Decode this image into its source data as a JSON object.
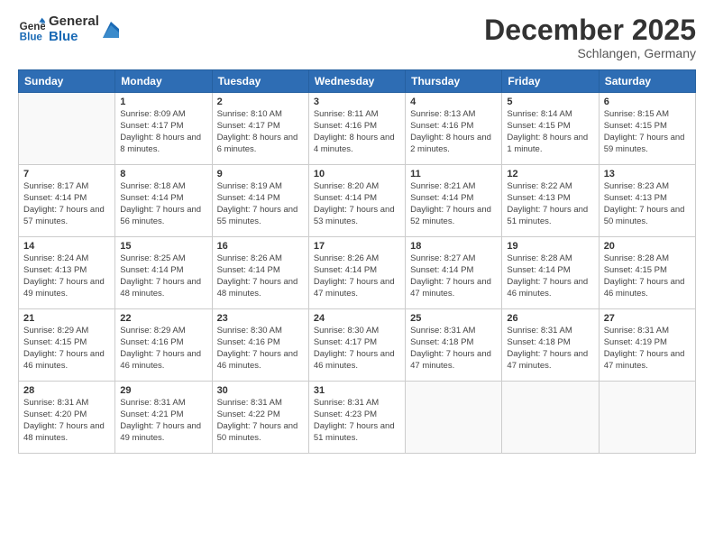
{
  "header": {
    "logo_line1": "General",
    "logo_line2": "Blue",
    "month_title": "December 2025",
    "location": "Schlangen, Germany"
  },
  "weekdays": [
    "Sunday",
    "Monday",
    "Tuesday",
    "Wednesday",
    "Thursday",
    "Friday",
    "Saturday"
  ],
  "weeks": [
    [
      {
        "day": "",
        "sunrise": "",
        "sunset": "",
        "daylight": ""
      },
      {
        "day": "1",
        "sunrise": "Sunrise: 8:09 AM",
        "sunset": "Sunset: 4:17 PM",
        "daylight": "Daylight: 8 hours and 8 minutes."
      },
      {
        "day": "2",
        "sunrise": "Sunrise: 8:10 AM",
        "sunset": "Sunset: 4:17 PM",
        "daylight": "Daylight: 8 hours and 6 minutes."
      },
      {
        "day": "3",
        "sunrise": "Sunrise: 8:11 AM",
        "sunset": "Sunset: 4:16 PM",
        "daylight": "Daylight: 8 hours and 4 minutes."
      },
      {
        "day": "4",
        "sunrise": "Sunrise: 8:13 AM",
        "sunset": "Sunset: 4:16 PM",
        "daylight": "Daylight: 8 hours and 2 minutes."
      },
      {
        "day": "5",
        "sunrise": "Sunrise: 8:14 AM",
        "sunset": "Sunset: 4:15 PM",
        "daylight": "Daylight: 8 hours and 1 minute."
      },
      {
        "day": "6",
        "sunrise": "Sunrise: 8:15 AM",
        "sunset": "Sunset: 4:15 PM",
        "daylight": "Daylight: 7 hours and 59 minutes."
      }
    ],
    [
      {
        "day": "7",
        "sunrise": "Sunrise: 8:17 AM",
        "sunset": "Sunset: 4:14 PM",
        "daylight": "Daylight: 7 hours and 57 minutes."
      },
      {
        "day": "8",
        "sunrise": "Sunrise: 8:18 AM",
        "sunset": "Sunset: 4:14 PM",
        "daylight": "Daylight: 7 hours and 56 minutes."
      },
      {
        "day": "9",
        "sunrise": "Sunrise: 8:19 AM",
        "sunset": "Sunset: 4:14 PM",
        "daylight": "Daylight: 7 hours and 55 minutes."
      },
      {
        "day": "10",
        "sunrise": "Sunrise: 8:20 AM",
        "sunset": "Sunset: 4:14 PM",
        "daylight": "Daylight: 7 hours and 53 minutes."
      },
      {
        "day": "11",
        "sunrise": "Sunrise: 8:21 AM",
        "sunset": "Sunset: 4:14 PM",
        "daylight": "Daylight: 7 hours and 52 minutes."
      },
      {
        "day": "12",
        "sunrise": "Sunrise: 8:22 AM",
        "sunset": "Sunset: 4:13 PM",
        "daylight": "Daylight: 7 hours and 51 minutes."
      },
      {
        "day": "13",
        "sunrise": "Sunrise: 8:23 AM",
        "sunset": "Sunset: 4:13 PM",
        "daylight": "Daylight: 7 hours and 50 minutes."
      }
    ],
    [
      {
        "day": "14",
        "sunrise": "Sunrise: 8:24 AM",
        "sunset": "Sunset: 4:13 PM",
        "daylight": "Daylight: 7 hours and 49 minutes."
      },
      {
        "day": "15",
        "sunrise": "Sunrise: 8:25 AM",
        "sunset": "Sunset: 4:14 PM",
        "daylight": "Daylight: 7 hours and 48 minutes."
      },
      {
        "day": "16",
        "sunrise": "Sunrise: 8:26 AM",
        "sunset": "Sunset: 4:14 PM",
        "daylight": "Daylight: 7 hours and 48 minutes."
      },
      {
        "day": "17",
        "sunrise": "Sunrise: 8:26 AM",
        "sunset": "Sunset: 4:14 PM",
        "daylight": "Daylight: 7 hours and 47 minutes."
      },
      {
        "day": "18",
        "sunrise": "Sunrise: 8:27 AM",
        "sunset": "Sunset: 4:14 PM",
        "daylight": "Daylight: 7 hours and 47 minutes."
      },
      {
        "day": "19",
        "sunrise": "Sunrise: 8:28 AM",
        "sunset": "Sunset: 4:14 PM",
        "daylight": "Daylight: 7 hours and 46 minutes."
      },
      {
        "day": "20",
        "sunrise": "Sunrise: 8:28 AM",
        "sunset": "Sunset: 4:15 PM",
        "daylight": "Daylight: 7 hours and 46 minutes."
      }
    ],
    [
      {
        "day": "21",
        "sunrise": "Sunrise: 8:29 AM",
        "sunset": "Sunset: 4:15 PM",
        "daylight": "Daylight: 7 hours and 46 minutes."
      },
      {
        "day": "22",
        "sunrise": "Sunrise: 8:29 AM",
        "sunset": "Sunset: 4:16 PM",
        "daylight": "Daylight: 7 hours and 46 minutes."
      },
      {
        "day": "23",
        "sunrise": "Sunrise: 8:30 AM",
        "sunset": "Sunset: 4:16 PM",
        "daylight": "Daylight: 7 hours and 46 minutes."
      },
      {
        "day": "24",
        "sunrise": "Sunrise: 8:30 AM",
        "sunset": "Sunset: 4:17 PM",
        "daylight": "Daylight: 7 hours and 46 minutes."
      },
      {
        "day": "25",
        "sunrise": "Sunrise: 8:31 AM",
        "sunset": "Sunset: 4:18 PM",
        "daylight": "Daylight: 7 hours and 47 minutes."
      },
      {
        "day": "26",
        "sunrise": "Sunrise: 8:31 AM",
        "sunset": "Sunset: 4:18 PM",
        "daylight": "Daylight: 7 hours and 47 minutes."
      },
      {
        "day": "27",
        "sunrise": "Sunrise: 8:31 AM",
        "sunset": "Sunset: 4:19 PM",
        "daylight": "Daylight: 7 hours and 47 minutes."
      }
    ],
    [
      {
        "day": "28",
        "sunrise": "Sunrise: 8:31 AM",
        "sunset": "Sunset: 4:20 PM",
        "daylight": "Daylight: 7 hours and 48 minutes."
      },
      {
        "day": "29",
        "sunrise": "Sunrise: 8:31 AM",
        "sunset": "Sunset: 4:21 PM",
        "daylight": "Daylight: 7 hours and 49 minutes."
      },
      {
        "day": "30",
        "sunrise": "Sunrise: 8:31 AM",
        "sunset": "Sunset: 4:22 PM",
        "daylight": "Daylight: 7 hours and 50 minutes."
      },
      {
        "day": "31",
        "sunrise": "Sunrise: 8:31 AM",
        "sunset": "Sunset: 4:23 PM",
        "daylight": "Daylight: 7 hours and 51 minutes."
      },
      {
        "day": "",
        "sunrise": "",
        "sunset": "",
        "daylight": ""
      },
      {
        "day": "",
        "sunrise": "",
        "sunset": "",
        "daylight": ""
      },
      {
        "day": "",
        "sunrise": "",
        "sunset": "",
        "daylight": ""
      }
    ]
  ]
}
